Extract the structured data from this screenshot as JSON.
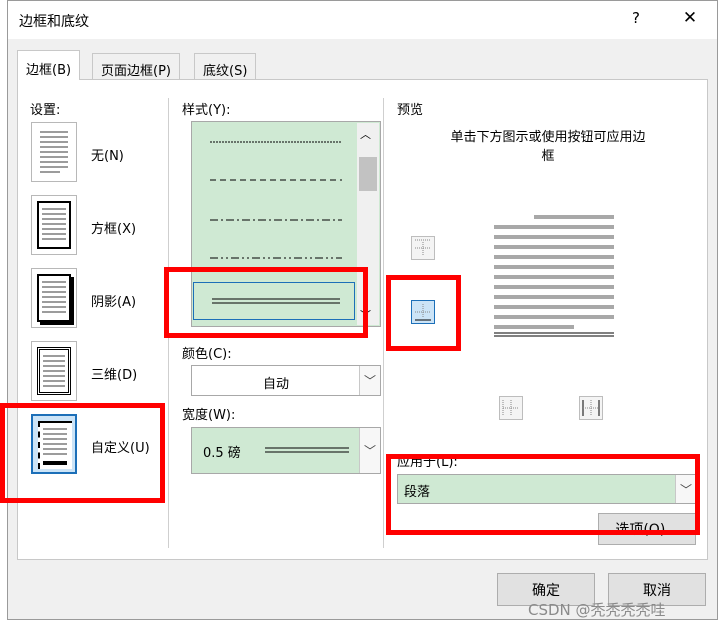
{
  "dialog": {
    "title": "边框和底纹",
    "help_label": "?",
    "close_label": "✕"
  },
  "tabs": [
    {
      "label": "边框(B)",
      "active": true
    },
    {
      "label": "页面边框(P)",
      "active": false
    },
    {
      "label": "底纹(S)",
      "active": false
    }
  ],
  "settings": {
    "header": "设置:",
    "items": [
      {
        "label": "无(N)"
      },
      {
        "label": "方框(X)"
      },
      {
        "label": "阴影(A)"
      },
      {
        "label": "三维(D)"
      },
      {
        "label": "自定义(U)",
        "selected": true
      }
    ]
  },
  "style": {
    "header": "样式(Y):",
    "scroll_up": "︿",
    "scroll_down": "﹀"
  },
  "color": {
    "header": "颜色(C):",
    "value": "自动"
  },
  "width": {
    "header": "宽度(W):",
    "value": "0.5 磅"
  },
  "preview": {
    "header": "预览",
    "instruction": "单击下方图示或使用按钮可应用边框"
  },
  "apply_to": {
    "header": "应用于(L):",
    "value": "段落"
  },
  "buttons": {
    "options": "选项(O)...",
    "ok": "确定",
    "cancel": "取消"
  },
  "watermark": "CSDN @秃秃秃秃哇",
  "colors": {
    "list_bg": "#cfe9d3",
    "highlight": "#ff0000",
    "selected_icon": "#1c6fb8"
  }
}
